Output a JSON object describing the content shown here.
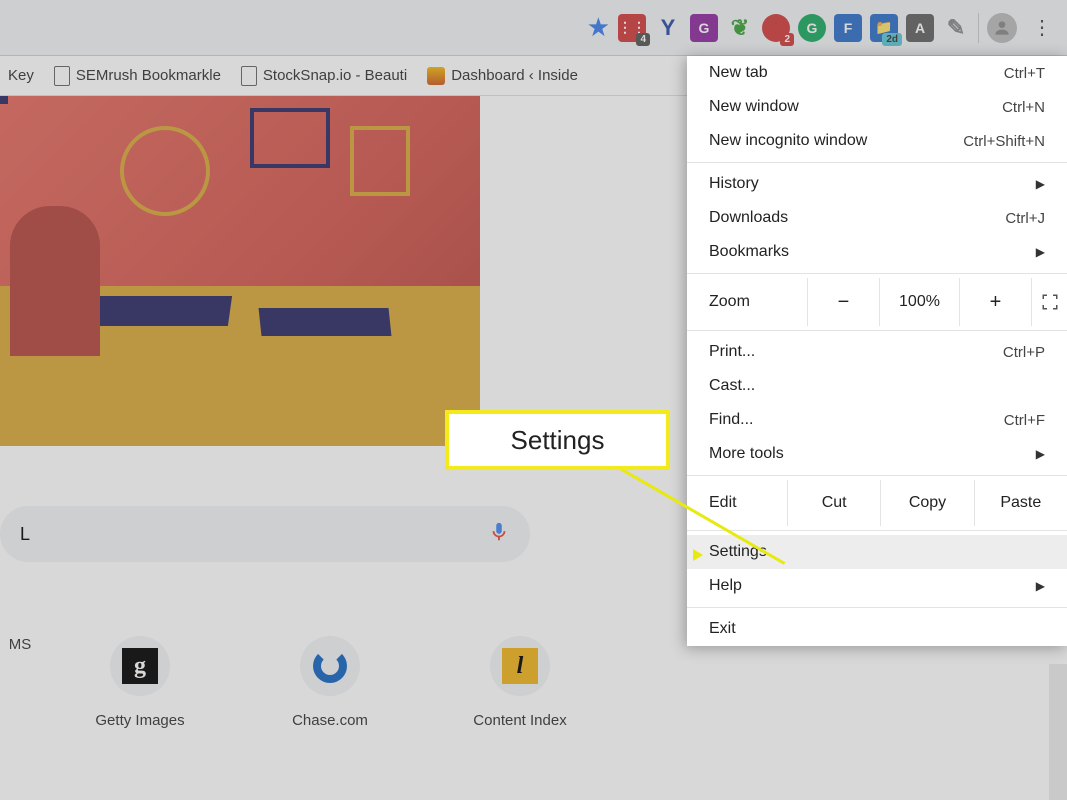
{
  "bookmarks": {
    "key": "Key",
    "semrush": "SEMrush Bookmarkle",
    "stocksnap": "StockSnap.io - Beauti",
    "dashboard": "Dashboard ‹ Inside"
  },
  "search": {
    "placeholder": "L"
  },
  "shortcuts": {
    "ms": "MS",
    "getty": "Getty Images",
    "chase": "Chase.com",
    "content": "Content Index"
  },
  "menu": {
    "newtab": "New tab",
    "newtab_sc": "Ctrl+T",
    "newwin": "New window",
    "newwin_sc": "Ctrl+N",
    "incog": "New incognito window",
    "incog_sc": "Ctrl+Shift+N",
    "history": "History",
    "downloads": "Downloads",
    "downloads_sc": "Ctrl+J",
    "bookmarks": "Bookmarks",
    "zoom": "Zoom",
    "zoom_val": "100%",
    "print": "Print...",
    "print_sc": "Ctrl+P",
    "cast": "Cast...",
    "find": "Find...",
    "find_sc": "Ctrl+F",
    "moretools": "More tools",
    "edit": "Edit",
    "cut": "Cut",
    "copy": "Copy",
    "paste": "Paste",
    "settings": "Settings",
    "help": "Help",
    "exit": "Exit"
  },
  "callout": "Settings",
  "ext_badges": {
    "red": "4",
    "vine": "2",
    "folder": "2d"
  }
}
